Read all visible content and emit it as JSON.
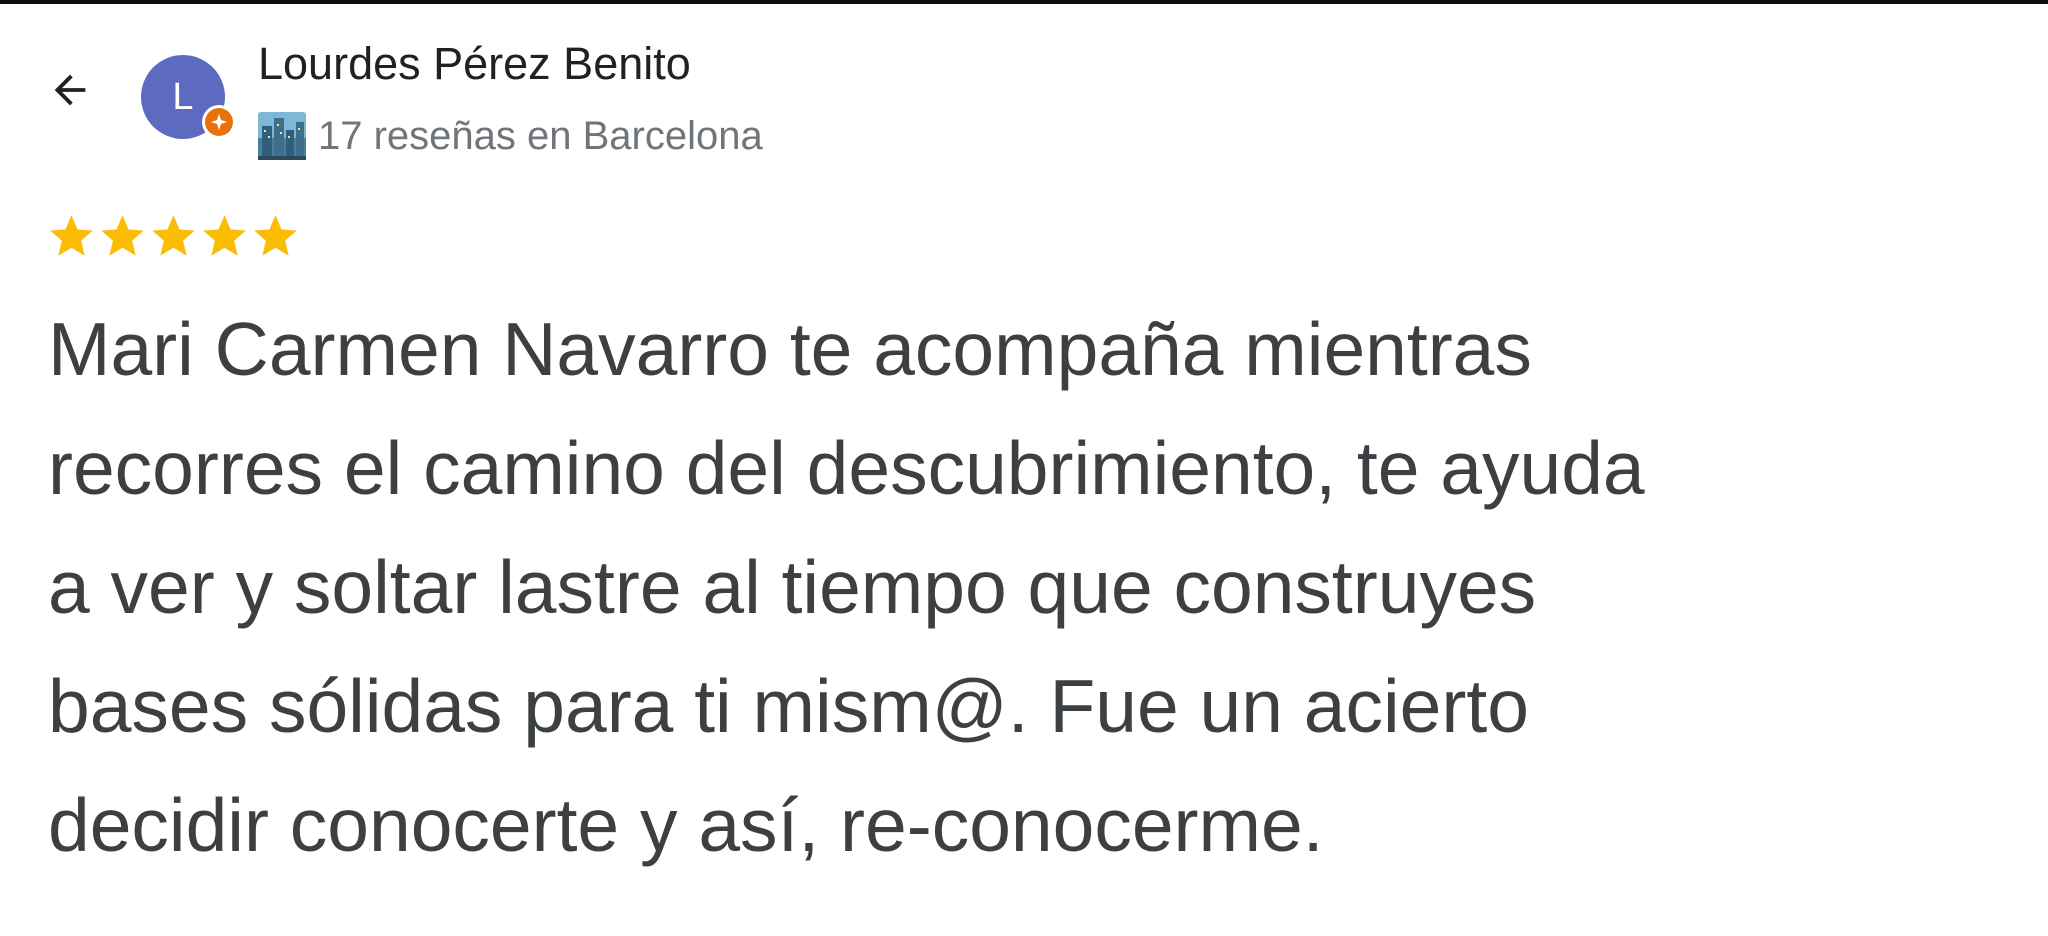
{
  "header": {
    "back_icon": "arrow-left-icon",
    "avatar": {
      "initial": "L",
      "color": "#5c6bc0",
      "badge_icon": "local-guide-sparkle-icon",
      "badge_color": "#e8710a"
    },
    "reviewer_name": "Lourdes Pérez Benito",
    "location_icon": "cityscape-icon",
    "review_count_text": "17 reseñas en Barcelona"
  },
  "rating": {
    "stars": 5,
    "max": 5,
    "star_icon": "star-icon",
    "color": "#fbbc04"
  },
  "review": {
    "lines": [
      "Mari Carmen Navarro te acompaña mientras",
      "recorres el camino del descubrimiento, te ayuda",
      "a ver y soltar lastre al tiempo que construyes",
      "bases sólidas para ti mism@. Fue un acierto",
      "decidir conocerte y así, re-conocerme."
    ]
  }
}
